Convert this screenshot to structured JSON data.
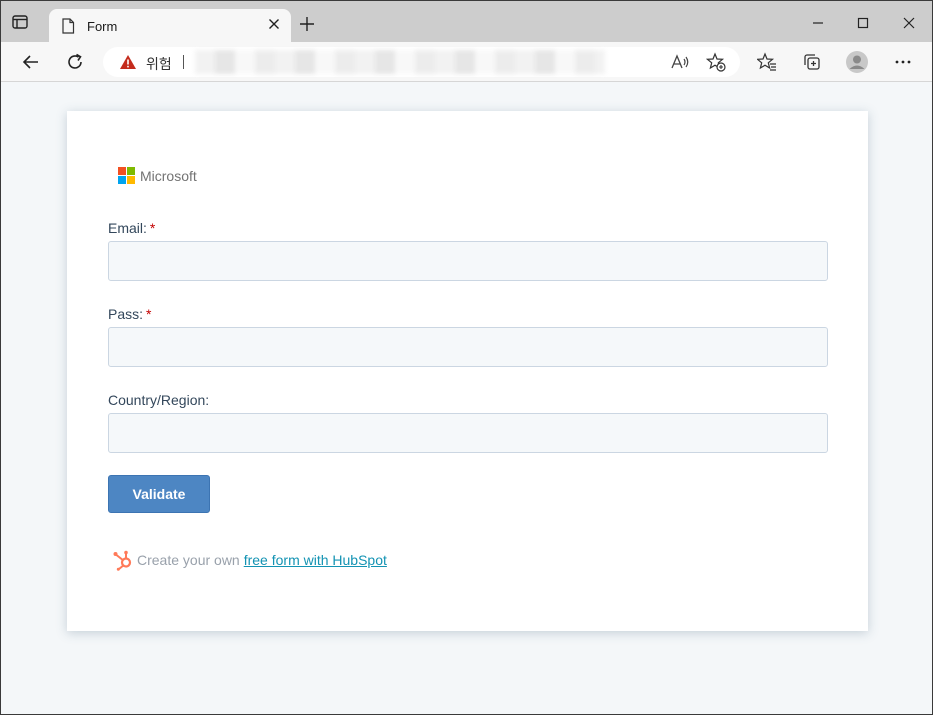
{
  "browser": {
    "tab_title": "Form",
    "security_warning_text": "위험",
    "icons": {
      "tab_actions": "tab-actions-icon",
      "page": "page-icon",
      "close_tab": "close-icon",
      "new_tab": "plus-icon",
      "minimize": "minimize-icon",
      "maximize": "maximize-icon",
      "close_window": "close-icon",
      "back": "back-arrow-icon",
      "refresh": "refresh-icon",
      "warning": "warning-triangle-icon",
      "read_aloud": "read-aloud-icon",
      "add_favorite": "star-plus-icon",
      "favorites": "favorites-icon",
      "collections": "collections-icon",
      "profile": "profile-avatar-icon",
      "more": "more-dots-icon"
    }
  },
  "form": {
    "logo_text": "Microsoft",
    "logo_colors": [
      "#f25022",
      "#7fba00",
      "#00a4ef",
      "#ffb900"
    ],
    "fields": [
      {
        "label": "Email:",
        "required_mark": "*",
        "value": ""
      },
      {
        "label": "Pass:",
        "required_mark": "*",
        "value": ""
      },
      {
        "label": "Country/Region:",
        "required_mark": "",
        "value": ""
      }
    ],
    "submit_label": "Validate",
    "footer_prefix": "Create your own",
    "footer_link": "free form with HubSpot"
  },
  "colors": {
    "button": "#4d86c3",
    "link": "#1393b3",
    "hubspot_orange": "#ff7a59",
    "required": "#c30000"
  }
}
